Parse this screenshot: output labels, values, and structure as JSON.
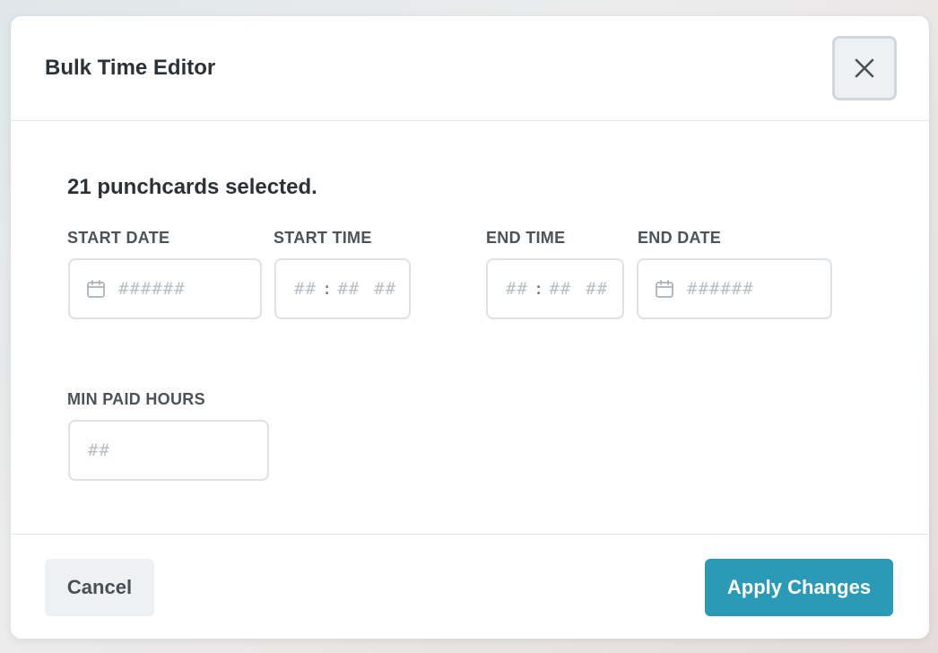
{
  "modal": {
    "title": "Bulk Time Editor",
    "close_icon": "close-icon"
  },
  "body": {
    "selected_text": "21 punchcards selected.",
    "start_date": {
      "label": "START DATE",
      "placeholder": "######",
      "icon": "calendar-icon"
    },
    "start_time": {
      "label": "START TIME",
      "hours_placeholder": "##",
      "separator": ":",
      "minutes_placeholder": "##",
      "period_placeholder": "##"
    },
    "end_time": {
      "label": "END TIME",
      "hours_placeholder": "##",
      "separator": ":",
      "minutes_placeholder": "##",
      "period_placeholder": "##"
    },
    "end_date": {
      "label": "END DATE",
      "placeholder": "######",
      "icon": "calendar-icon"
    },
    "min_paid_hours": {
      "label": "MIN PAID HOURS",
      "placeholder": "##"
    }
  },
  "footer": {
    "cancel_label": "Cancel",
    "apply_label": "Apply Changes"
  },
  "colors": {
    "primary": "#2a9ab7",
    "text_dark": "#2a3238",
    "label": "#4a5358",
    "placeholder": "#b8bfc4",
    "border": "#dde2e6",
    "secondary_button_bg": "#eef1f3"
  }
}
